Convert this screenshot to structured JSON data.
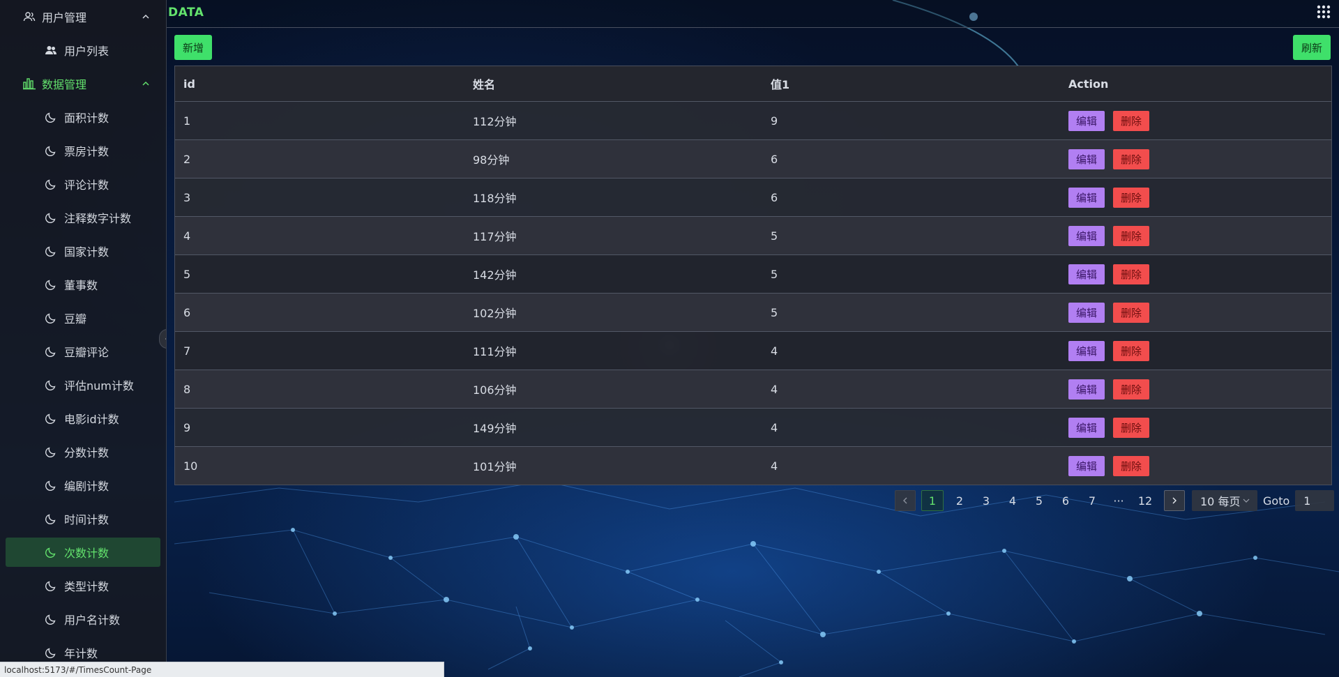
{
  "header": {
    "brand": "DATA"
  },
  "toolbar": {
    "add_label": "新增",
    "refresh_label": "刷新"
  },
  "sidebar": {
    "groups": [
      {
        "label": "用户管理",
        "items": [
          {
            "label": "用户列表"
          }
        ]
      },
      {
        "label": "数据管理",
        "items": [
          {
            "label": "面积计数"
          },
          {
            "label": "票房计数"
          },
          {
            "label": "评论计数"
          },
          {
            "label": "注释数字计数"
          },
          {
            "label": "国家计数"
          },
          {
            "label": "董事数"
          },
          {
            "label": "豆瓣"
          },
          {
            "label": "豆瓣评论"
          },
          {
            "label": "评估num计数"
          },
          {
            "label": "电影id计数"
          },
          {
            "label": "分数计数"
          },
          {
            "label": "编剧计数"
          },
          {
            "label": "时间计数"
          },
          {
            "label": "次数计数"
          },
          {
            "label": "类型计数"
          },
          {
            "label": "用户名计数"
          },
          {
            "label": "年计数"
          }
        ]
      }
    ]
  },
  "table": {
    "columns": [
      "id",
      "姓名",
      "值1",
      "Action"
    ],
    "edit_label": "编辑",
    "delete_label": "删除",
    "rows": [
      {
        "id": "1",
        "name": "112分钟",
        "value": "9"
      },
      {
        "id": "2",
        "name": "98分钟",
        "value": "6"
      },
      {
        "id": "3",
        "name": "118分钟",
        "value": "6"
      },
      {
        "id": "4",
        "name": "117分钟",
        "value": "5"
      },
      {
        "id": "5",
        "name": "142分钟",
        "value": "5"
      },
      {
        "id": "6",
        "name": "102分钟",
        "value": "5"
      },
      {
        "id": "7",
        "name": "111分钟",
        "value": "4"
      },
      {
        "id": "8",
        "name": "106分钟",
        "value": "4"
      },
      {
        "id": "9",
        "name": "149分钟",
        "value": "4"
      },
      {
        "id": "10",
        "name": "101分钟",
        "value": "4"
      }
    ]
  },
  "pagination": {
    "pages": [
      "1",
      "2",
      "3",
      "4",
      "5",
      "6",
      "7",
      "···",
      "12"
    ],
    "current": "1",
    "page_size": "10 每页",
    "goto_label": "Goto",
    "goto_value": "1"
  },
  "status_url": "localhost:5173/#/TimesCount-Page",
  "colors": {
    "accent": "#63e26d",
    "edit": "#b17ff2",
    "delete": "#f24d4d",
    "primary_btn": "#3fe06a"
  }
}
